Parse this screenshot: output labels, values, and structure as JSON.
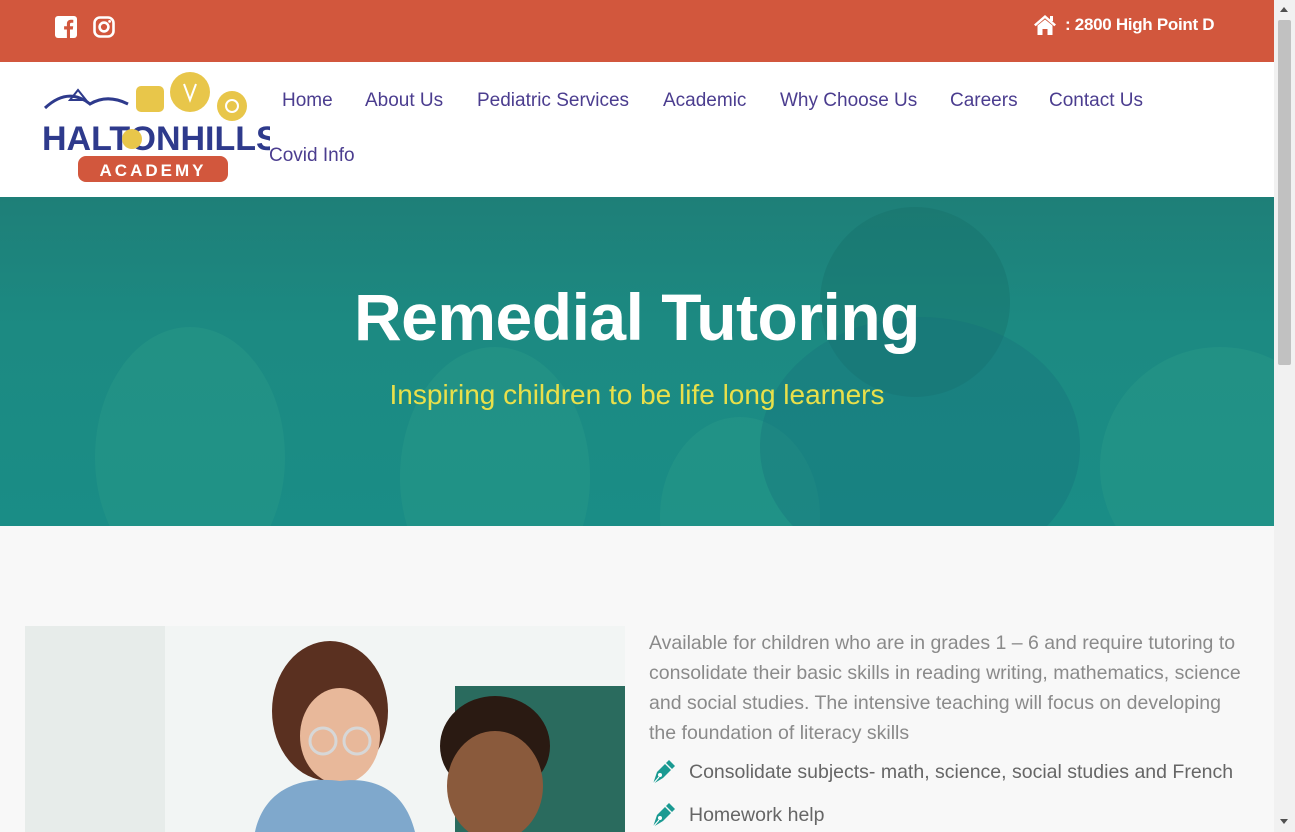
{
  "topbar": {
    "address": ": 2800 High Point D",
    "social": [
      "facebook-icon",
      "instagram-icon"
    ],
    "bg_color": "#d2573d"
  },
  "logo": {
    "line1": "HALTONHILLS",
    "line2": "ACADEMY"
  },
  "nav": {
    "items": [
      "Home",
      "About Us",
      "Pediatric Services",
      "Academic",
      "Why Choose Us",
      "Careers",
      "Contact Us",
      "Covid Info"
    ],
    "color": "#4b3d8f"
  },
  "hero": {
    "title": "Remedial Tutoring",
    "subtitle": "Inspiring children to be life long learners",
    "subtitle_color": "#e9e04a"
  },
  "content": {
    "description": "Available for children who are in grades 1 – 6 and require tutoring to consolidate their basic skills in reading writing, mathematics, science and social studies. The intensive teaching will focus on developing the foundation of literacy skills",
    "bullets": [
      "Consolidate subjects- math, science, social studies and French",
      "Homework help"
    ],
    "bullet_icon": "pen-nib-icon",
    "accent_color": "#1a9a92"
  }
}
